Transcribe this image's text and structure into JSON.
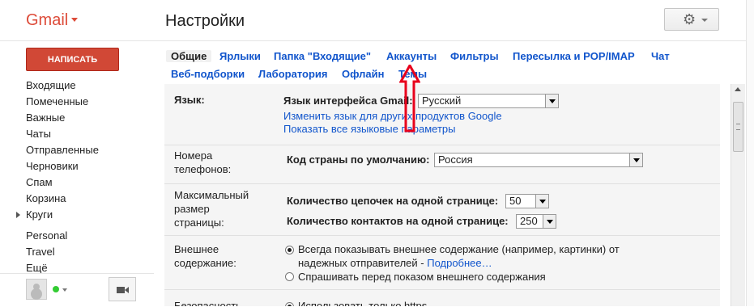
{
  "app": {
    "logo": "Gmail",
    "page_title": "Настройки"
  },
  "compose": {
    "label": "НАПИСАТЬ"
  },
  "nav": {
    "items": [
      {
        "label": "Входящие"
      },
      {
        "label": "Помеченные"
      },
      {
        "label": "Важные"
      },
      {
        "label": "Чаты"
      },
      {
        "label": "Отправленные"
      },
      {
        "label": "Черновики"
      },
      {
        "label": "Спам"
      },
      {
        "label": "Корзина"
      },
      {
        "label": "Круги"
      }
    ],
    "extra": [
      {
        "label": "Personal"
      },
      {
        "label": "Travel"
      },
      {
        "label": "Ещё"
      }
    ]
  },
  "tabs": [
    {
      "label": "Общие",
      "active": true
    },
    {
      "label": "Ярлыки"
    },
    {
      "label": "Папка \"Входящие\""
    },
    {
      "label": "Аккаунты"
    },
    {
      "label": "Фильтры"
    },
    {
      "label": "Пересылка и POP/IMAP"
    },
    {
      "label": "Чат"
    },
    {
      "label": "Веб-подборки"
    },
    {
      "label": "Лаборатория"
    },
    {
      "label": "Офлайн"
    },
    {
      "label": "Темы"
    }
  ],
  "settings": {
    "language": {
      "label": "Язык:",
      "interface_label": "Язык интерфейса Gmail:",
      "interface_value": "Русский",
      "change_link": "Изменить язык для других продуктов Google",
      "show_all_link": "Показать все языковые параметры"
    },
    "phone": {
      "label_line1": "Номера",
      "label_line2": "телефонов:",
      "country_label": "Код страны по умолчанию:",
      "country_value": "Россия"
    },
    "page_size": {
      "label_line1": "Максимальный",
      "label_line2": "размер",
      "label_line3": "страницы:",
      "threads_label": "Количество цепочек на одной странице:",
      "threads_value": "50",
      "contacts_label": "Количество контактов на одной странице:",
      "contacts_value": "250"
    },
    "external": {
      "label_line1": "Внешнее",
      "label_line2": "содержание:",
      "option1_line1": "Всегда показывать внешнее содержание (например, картинки) от",
      "option1_line2": "надежных отправителей - ",
      "option1_link": "Подробнее…",
      "option2": "Спрашивать перед показом внешнего содержания"
    },
    "security": {
      "label": "Безопасность",
      "option1": "Использовать только https"
    }
  },
  "colors": {
    "brand_red": "#dd4b39",
    "compose_red": "#d14836",
    "link_blue": "#1155cc",
    "annotation_red": "#e8001c"
  },
  "icons": {
    "settings": "gear-icon",
    "video": "video-camera-icon",
    "avatar": "user-avatar-icon"
  }
}
